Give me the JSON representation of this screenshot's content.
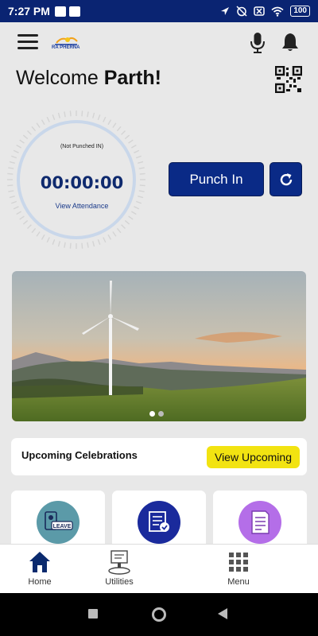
{
  "status_bar": {
    "time": "7:27 PM",
    "battery": "100"
  },
  "header": {
    "logo_text": "RA PHERNA"
  },
  "welcome": {
    "greeting": "Welcome",
    "name": "Parth!"
  },
  "attendance": {
    "status": "(Not Punched IN)",
    "timer": "00:00:00",
    "view_link": "View Attendance"
  },
  "actions": {
    "punch_label": "Punch In"
  },
  "banner": {
    "slides": 2,
    "active_slide": 1
  },
  "celebrations": {
    "title": "Upcoming Celebrations",
    "button_label": "View Upcoming"
  },
  "cards": [
    {
      "icon": "leave-icon",
      "label": "LEAVE",
      "color": "#5b9aa8"
    },
    {
      "icon": "checklist-icon",
      "color": "#1a2a9c"
    },
    {
      "icon": "notes-icon",
      "color": "#b46ee8"
    }
  ],
  "bottom_nav": {
    "items": [
      {
        "label": "Home",
        "icon": "home-icon"
      },
      {
        "label": "Utilities",
        "icon": "utilities-icon"
      },
      {
        "label": "Menu",
        "icon": "grid-icon"
      }
    ]
  },
  "colors": {
    "primary": "#0a2a86",
    "accent": "#f2e311",
    "status_bar": "#0a2472"
  }
}
